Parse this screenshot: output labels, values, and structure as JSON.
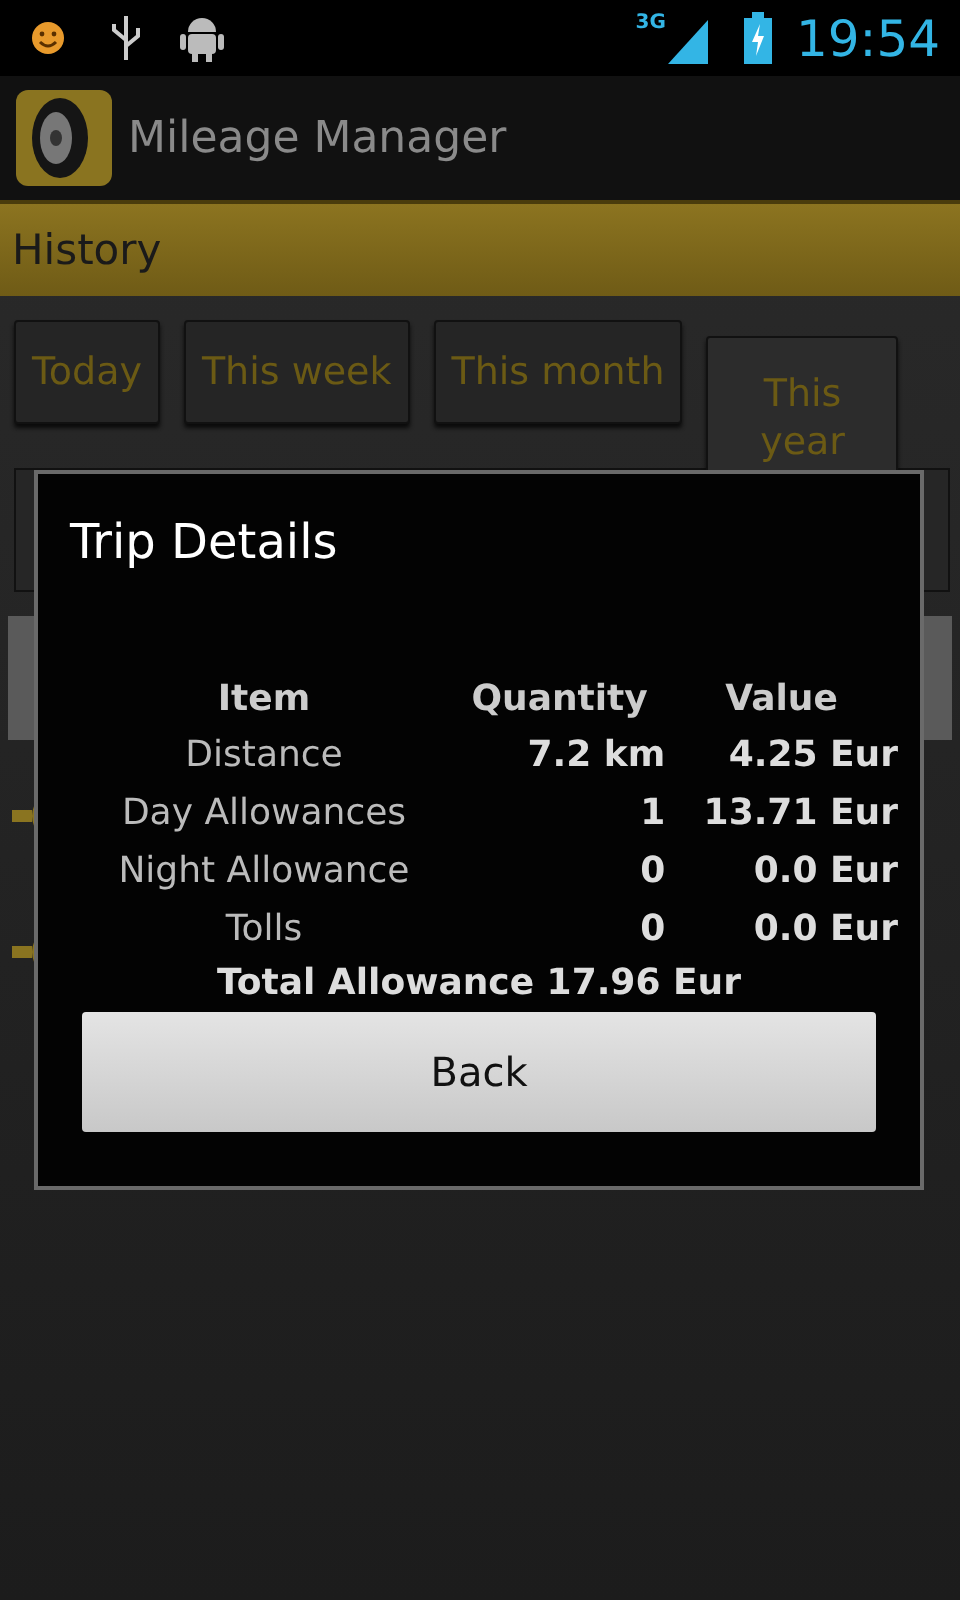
{
  "status_bar": {
    "network": "3G",
    "time": "19:54"
  },
  "app_bar": {
    "title": "Mileage Manager"
  },
  "section": {
    "title": "History"
  },
  "filters": [
    {
      "label": "Today",
      "selected": false
    },
    {
      "label": "This week",
      "selected": false
    },
    {
      "label": "This month",
      "selected": false
    },
    {
      "label": "This year",
      "selected": true
    }
  ],
  "dialog": {
    "title": "Trip Details",
    "columns": [
      "Item",
      "Quantity",
      "Value"
    ],
    "rows": [
      {
        "item": "Distance",
        "quantity": "7.2 km",
        "value": "4.25 Eur"
      },
      {
        "item": "Day Allowances",
        "quantity": "1",
        "value": "13.71 Eur"
      },
      {
        "item": "Night Allowance",
        "quantity": "0",
        "value": "0.0 Eur"
      },
      {
        "item": "Tolls",
        "quantity": "0",
        "value": "0.0 Eur"
      }
    ],
    "total": "Total Allowance 17.96 Eur",
    "button": "Back"
  }
}
